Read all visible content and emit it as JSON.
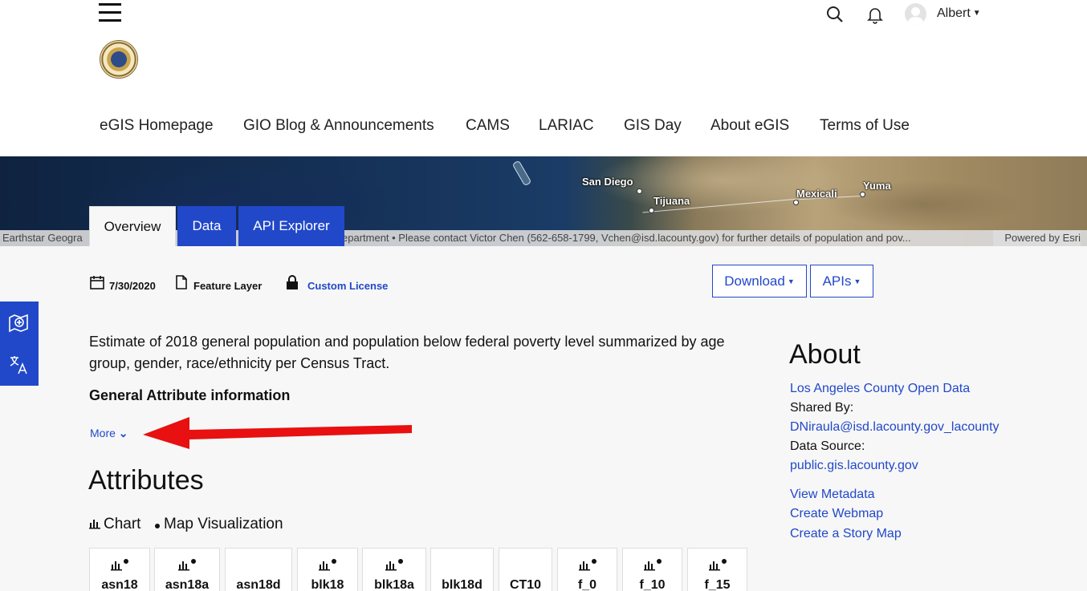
{
  "header": {
    "user_name": "Albert",
    "nav": [
      "eGIS Homepage",
      "GIO Blog & Announcements",
      "CAMS",
      "LARIAC",
      "GIS Day",
      "About eGIS",
      "Terms of Use"
    ]
  },
  "map": {
    "cities": [
      "San Diego",
      "Tijuana",
      "Mexicali",
      "Yuma"
    ],
    "attribution_left": "Earthstar Geogra",
    "attribution_mid": "epartment • Please contact Victor Chen (562-658-1799, Vchen@isd.lacounty.gov) for further details of population and pov...",
    "attribution_right": "Powered by Esri"
  },
  "tabs": [
    "Overview",
    "Data",
    "API Explorer"
  ],
  "meta": {
    "date": "7/30/2020",
    "type": "Feature Layer",
    "license": "Custom License"
  },
  "buttons": {
    "download": "Download",
    "apis": "APIs"
  },
  "description": "Estimate of 2018 general population and population below federal poverty level summarized by age group, gender, race/ethnicity per Census Tract.",
  "subheading": "General Attribute information",
  "more_label": "More",
  "attributes": {
    "title": "Attributes",
    "chart_label": "Chart",
    "map_label": "Map Visualization",
    "fields": [
      "asn18",
      "asn18a",
      "asn18d",
      "blk18",
      "blk18a",
      "blk18d",
      "CT10",
      "f_0",
      "f_10",
      "f_15"
    ]
  },
  "about": {
    "title": "About",
    "owner": "Los Angeles County Open Data",
    "shared_by_label": "Shared By:",
    "shared_by": "DNiraula@isd.lacounty.gov_lacounty",
    "data_source_label": "Data Source:",
    "data_source": "public.gis.lacounty.gov",
    "links": [
      "View Metadata",
      "Create Webmap",
      "Create a Story Map"
    ]
  },
  "colors": {
    "accent": "#2148c9",
    "arrow": "#e81010"
  }
}
